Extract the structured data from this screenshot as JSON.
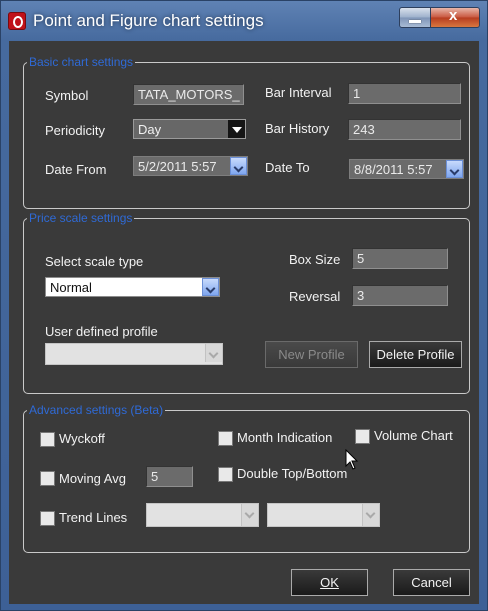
{
  "window": {
    "title": "Point and Figure chart settings"
  },
  "basic": {
    "legend": "Basic chart settings",
    "symbol_label": "Symbol",
    "symbol_value": "TATA_MOTORS_",
    "bar_interval_label": "Bar Interval",
    "bar_interval_value": "1",
    "periodicity_label": "Periodicity",
    "periodicity_value": "Day",
    "bar_history_label": "Bar History",
    "bar_history_value": "243",
    "date_from_label": "Date From",
    "date_from_value": "5/2/2011 5:57",
    "date_to_label": "Date To",
    "date_to_value": "8/8/2011 5:57"
  },
  "price": {
    "legend": "Price scale settings",
    "scale_type_label": "Select scale type",
    "scale_type_value": "Normal",
    "box_size_label": "Box Size",
    "box_size_value": "5",
    "reversal_label": "Reversal",
    "reversal_value": "3",
    "profile_label": "User defined profile",
    "profile_value": "",
    "new_profile_label": "New Profile",
    "delete_profile_label": "Delete Profile"
  },
  "advanced": {
    "legend": "Advanced settings (Beta)",
    "wyckoff_label": "Wyckoff",
    "wyckoff_checked": false,
    "month_indication_label": "Month Indication",
    "month_indication_checked": false,
    "volume_chart_label": "Volume Chart",
    "volume_chart_checked": false,
    "moving_avg_label": "Moving Avg",
    "moving_avg_checked": false,
    "moving_avg_value": "5",
    "double_top_label": "Double Top/Bottom",
    "double_top_checked": false,
    "trend_lines_label": "Trend Lines",
    "trend_lines_checked": false,
    "trend_select_1": "",
    "trend_select_2": ""
  },
  "footer": {
    "ok_label": "OK",
    "cancel_label": "Cancel"
  },
  "colors": {
    "legend_text": "#2f6ad6",
    "panel_background": "#3a3a3a",
    "title_bar": "#466a9e"
  }
}
